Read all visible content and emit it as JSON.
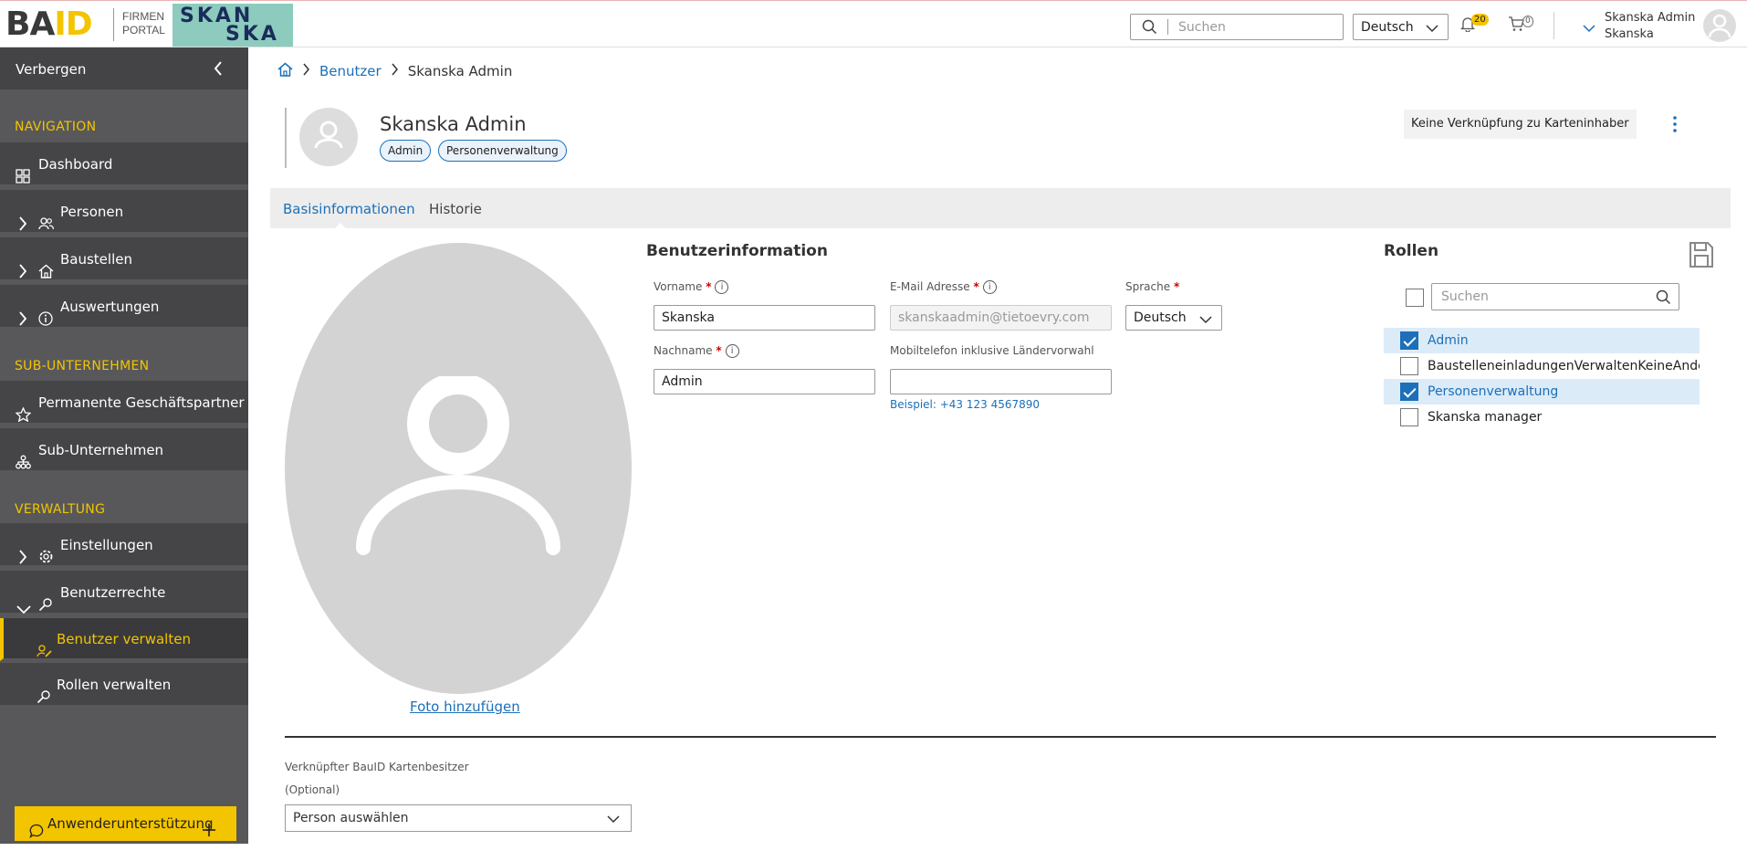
{
  "topbar": {
    "logo_main": "BA",
    "logo_accent": "ID",
    "firmen": "FIRMEN",
    "portal": "PORTAL",
    "brand_line1": "SKAN",
    "brand_line2": "SKA",
    "search_placeholder": "Suchen",
    "language": "Deutsch",
    "notifications_count": "20",
    "cart_count": "0",
    "user_name": "Skanska Admin",
    "user_company": "Skanska"
  },
  "sidebar": {
    "hide_label": "Verbergen",
    "section_navigation": "NAVIGATION",
    "dashboard": "Dashboard",
    "personen": "Personen",
    "baustellen": "Baustellen",
    "auswertungen": "Auswertungen",
    "section_sub": "SUB-UNTERNEHMEN",
    "permanente": "Permanente Geschäftspartner",
    "subunternehmen": "Sub-Unternehmen",
    "section_verwaltung": "VERWALTUNG",
    "einstellungen": "Einstellungen",
    "benutzerrechte": "Benutzerrechte",
    "benutzer_verwalten": "Benutzer verwalten",
    "rollen_verwalten": "Rollen verwalten",
    "help": "Anwenderunterstützung"
  },
  "breadcrumb": {
    "level1": "Benutzer",
    "level2": "Skanska Admin"
  },
  "header": {
    "name": "Skanska Admin",
    "tag1": "Admin",
    "tag2": "Personenverwaltung",
    "link_status": "Keine Verknüpfung zu Karteninhaber"
  },
  "tabs": {
    "basis": "Basisinformationen",
    "historie": "Historie"
  },
  "photo": {
    "add_label": "Foto hinzufügen"
  },
  "userinfo": {
    "title": "Benutzerinformation",
    "vorname_label": "Vorname",
    "vorname_value": "Skanska",
    "email_label": "E-Mail Adresse",
    "email_value": "skanskaadmin@tietoevry.com",
    "sprache_label": "Sprache",
    "sprache_value": "Deutsch",
    "nachname_label": "Nachname",
    "nachname_value": "Admin",
    "mobil_label": "Mobiltelefon inklusive Ländervorwahl",
    "mobil_value": "",
    "mobil_hint": "Beispiel: +43 123 4567890",
    "required_mark": "*"
  },
  "roles": {
    "title": "Rollen",
    "search_placeholder": "Suchen",
    "items": [
      {
        "label": "Admin",
        "checked": true
      },
      {
        "label": "BaustelleneinladungenVerwaltenKeineAnderungen",
        "checked": false
      },
      {
        "label": "Personenverwaltung",
        "checked": true
      },
      {
        "label": "Skanska manager",
        "checked": false
      }
    ]
  },
  "linked": {
    "label": "Verknüpfter BauID Kartenbesitzer",
    "optional": "(Optional)",
    "select_value": "Person auswählen"
  },
  "colors": {
    "accent": "#f3c400",
    "link": "#1d6fb8",
    "sidebar_bg": "#58585a"
  }
}
